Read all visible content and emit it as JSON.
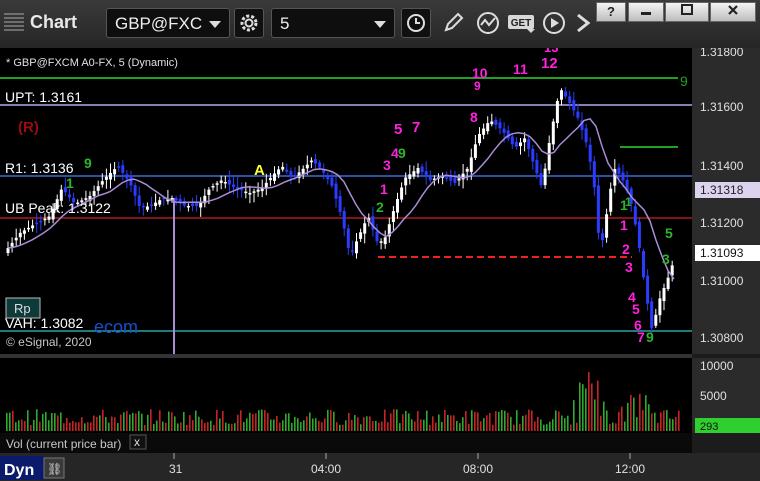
{
  "window": {
    "title": "Chart",
    "symbol": "GBP@FXC",
    "interval": "5",
    "controls": {
      "help": "?",
      "restore": "▭",
      "close": "✕"
    },
    "get_label": "GET"
  },
  "header": {
    "series_label": "* GBP@FXCM A0-FX, 5 (Dynamic)",
    "copyright": "© eSignal, 2020"
  },
  "levels": {
    "upt": "UPT: 1.3161",
    "r1": "R1: 1.3136",
    "ub_peak": "UB Peak: 1.3122",
    "vah": "VAH: 1.3082",
    "r_marker": "(R)",
    "a_marker": "A",
    "rp_badge": "Rp",
    "overlay_text": "ecom"
  },
  "price_axis": {
    "ticks": [
      "1.31800",
      "1.31600",
      "1.31400",
      "1.31200",
      "1.31000",
      "1.30800"
    ],
    "tag_ma": "1.31318",
    "tag_last": "1.31093"
  },
  "volume": {
    "ticks": [
      "10000",
      "5000"
    ],
    "last": "293",
    "label": "Vol (current price bar)",
    "close": "x"
  },
  "time_axis": {
    "ticks": [
      "31",
      "04:00",
      "08:00",
      "12:00"
    ],
    "dyn": "Dyn"
  },
  "signals": [
    {
      "t": "9",
      "c": "green"
    },
    {
      "t": "9",
      "c": "green"
    },
    {
      "t": "10",
      "c": "magenta"
    },
    {
      "t": "9",
      "c": "magenta"
    },
    {
      "t": "11",
      "c": "magenta"
    },
    {
      "t": "12",
      "c": "magenta"
    },
    {
      "t": "13",
      "c": "magenta"
    },
    {
      "t": "5",
      "c": "magenta"
    },
    {
      "t": "7",
      "c": "magenta"
    },
    {
      "t": "8",
      "c": "magenta"
    },
    {
      "t": "4",
      "c": "magenta"
    },
    {
      "t": "3",
      "c": "magenta"
    },
    {
      "t": "1",
      "c": "magenta"
    },
    {
      "t": "9",
      "c": "green"
    },
    {
      "t": "2",
      "c": "green"
    },
    {
      "t": "1",
      "c": "magenta"
    },
    {
      "t": "1",
      "c": "green"
    },
    {
      "t": "2",
      "c": "magenta"
    },
    {
      "t": "3",
      "c": "magenta"
    },
    {
      "t": "4",
      "c": "magenta"
    },
    {
      "t": "5",
      "c": "magenta"
    },
    {
      "t": "6",
      "c": "magenta"
    },
    {
      "t": "7",
      "c": "magenta"
    },
    {
      "t": "9",
      "c": "green"
    },
    {
      "t": "5",
      "c": "green"
    },
    {
      "t": "3",
      "c": "green"
    },
    {
      "t": "1",
      "c": "green"
    },
    {
      "t": "1",
      "c": "green"
    }
  ],
  "colors": {
    "bull": "#ffffff",
    "bear": "#2a3cff",
    "magenta": "#ff22dd",
    "green": "#2ab52a",
    "ma": "#a98bd6",
    "r1_line": "#3a6cd4",
    "upt_line": "#b7a7e6"
  }
}
